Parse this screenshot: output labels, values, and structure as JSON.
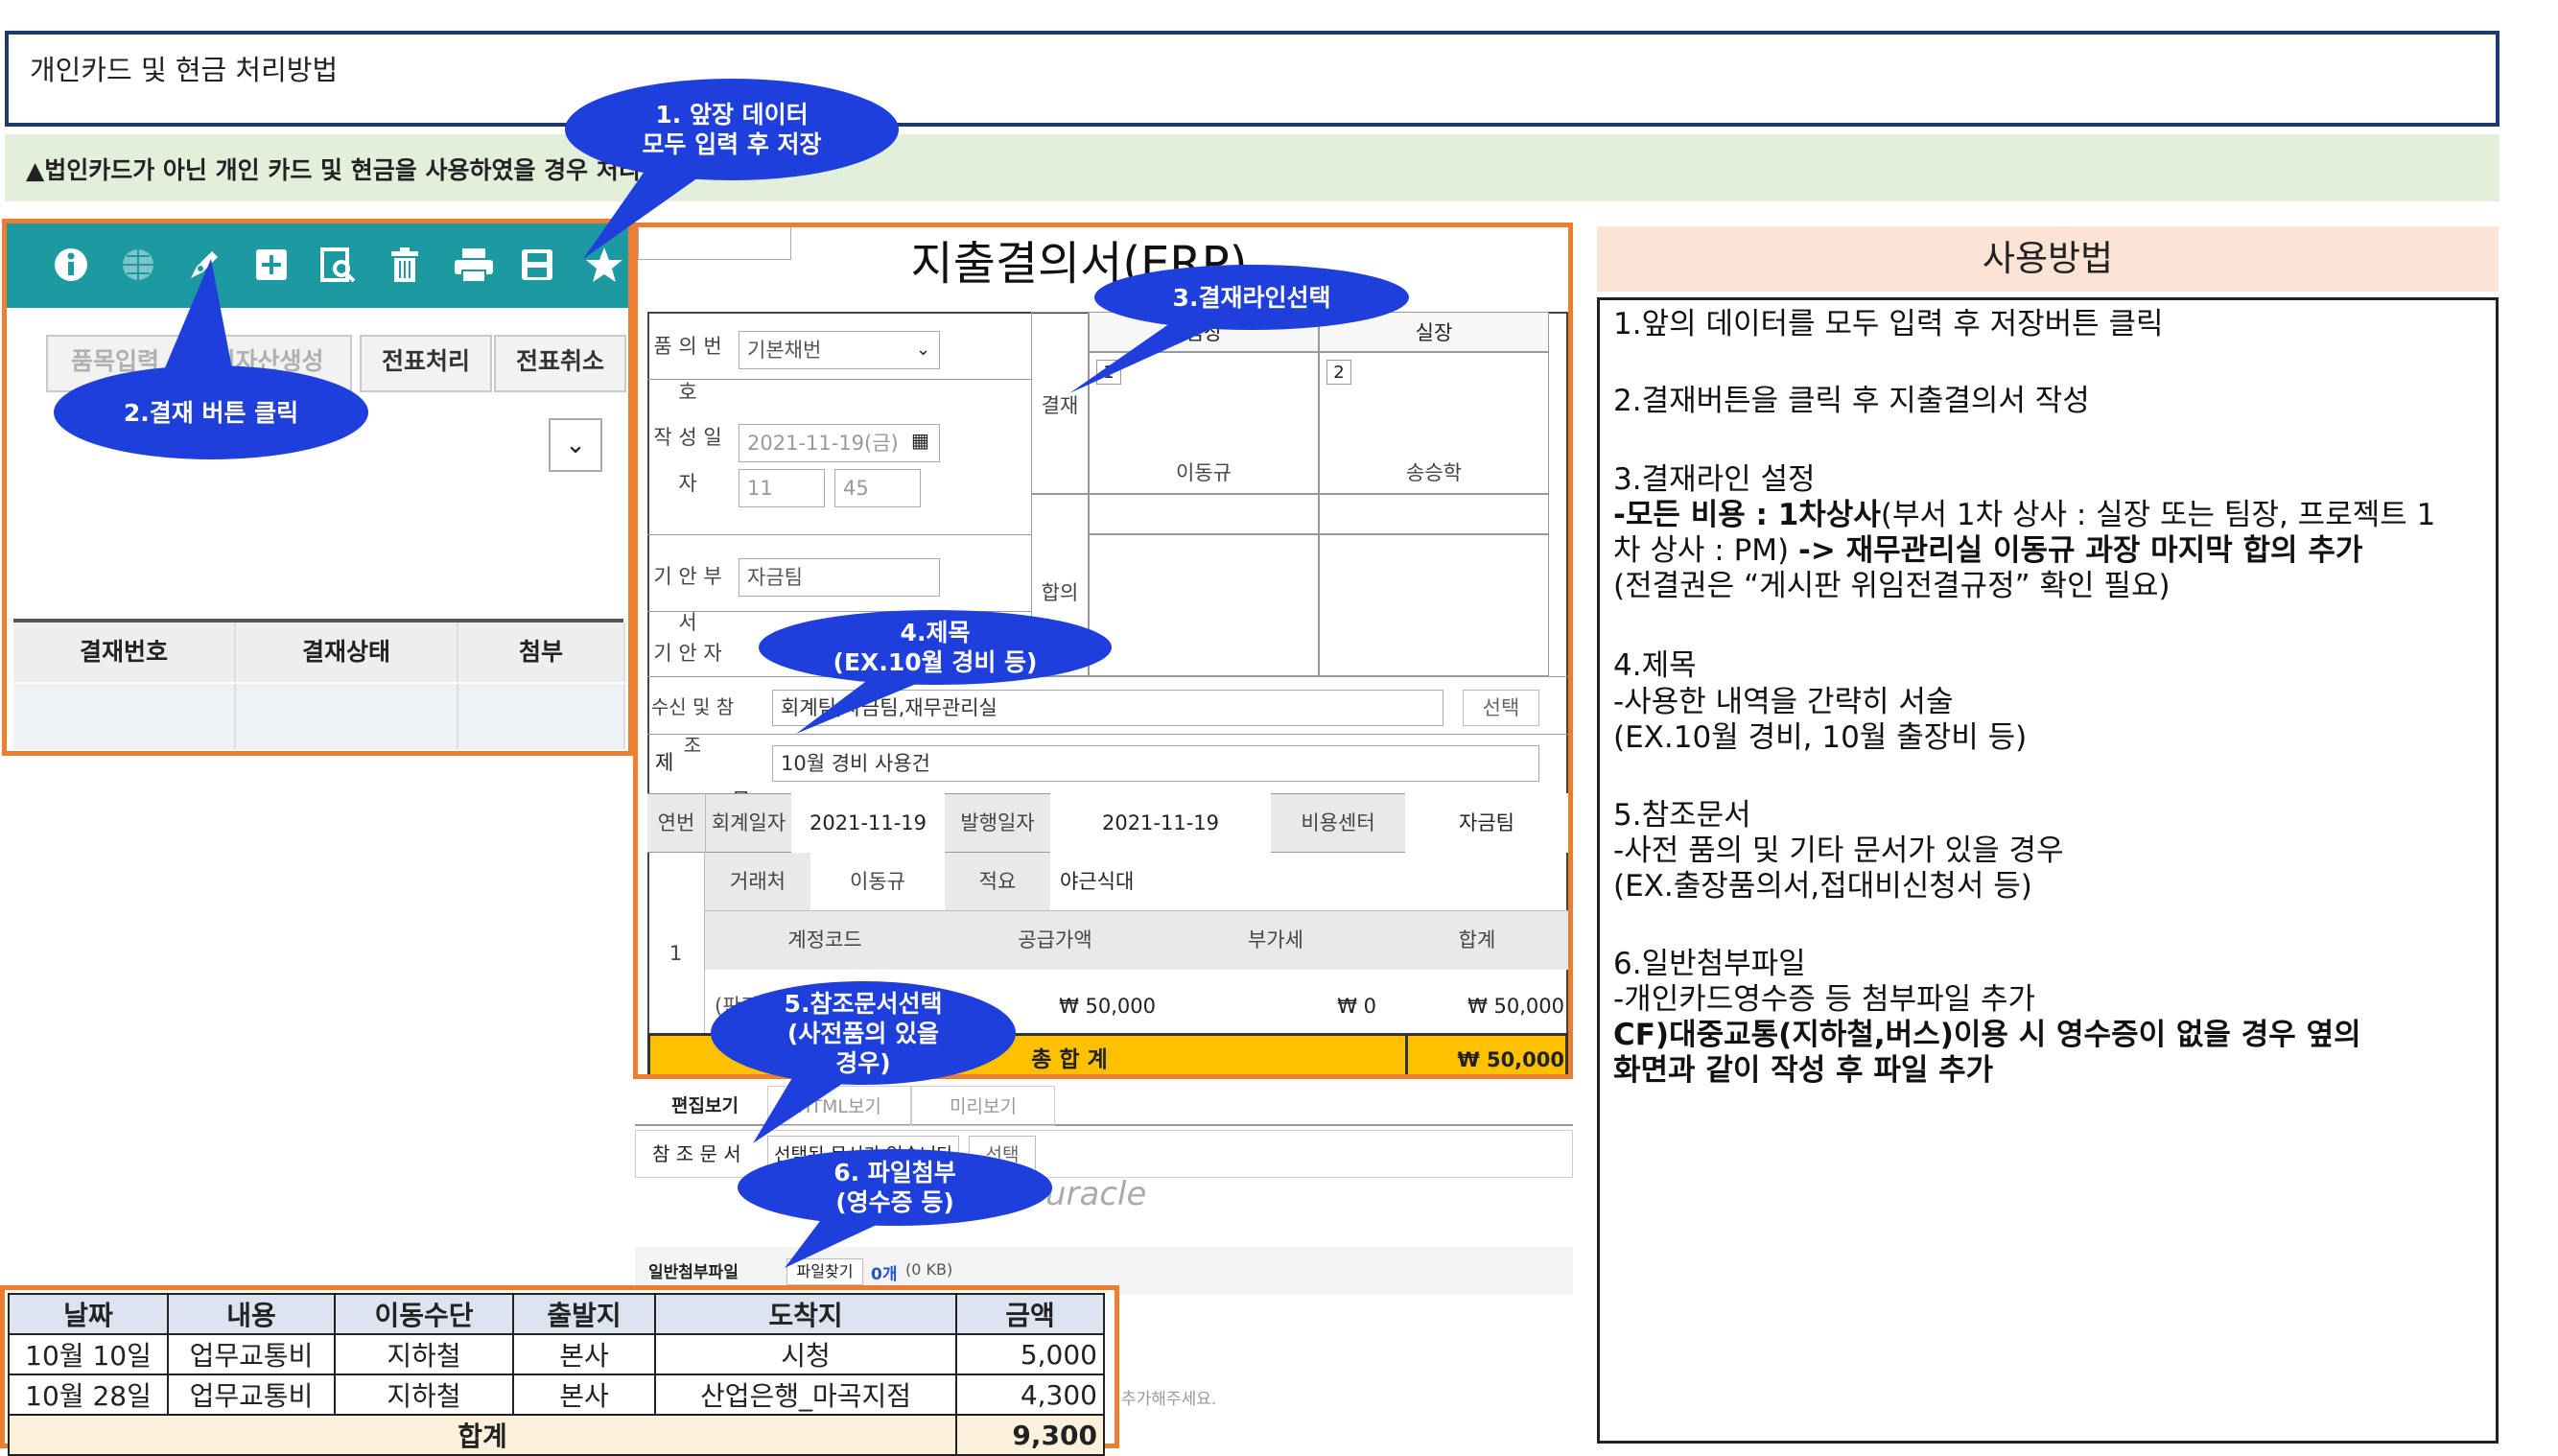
{
  "title": "개인카드 및 현금 처리방법",
  "notice": "▲법인카드가 아닌 개인 카드 및 현금을 사용하였을 경우 처리방법",
  "toolbar": {
    "icons": [
      "info-icon",
      "globe-icon",
      "pen-icon",
      "plus-icon",
      "preview-icon",
      "trash-icon",
      "print-icon",
      "save-icon",
      "star-icon"
    ],
    "buttons": [
      "품목입력",
      "전자산생성",
      "전표처리",
      "전표취소"
    ],
    "table_headers": [
      "결재번호",
      "결재상태",
      "첨부"
    ]
  },
  "form": {
    "title": "지출결의서(ERP)",
    "labels": {
      "doc_no": "품 의 번 호",
      "date": "작 성 일 자",
      "dept": "기 안 부 서",
      "drafter": "기 안 자",
      "recipient": "수신 및 참조",
      "subject": "제 목",
      "approval": "결재",
      "agreement": "합의",
      "approver2": "실장",
      "approver1": "팀장"
    },
    "doc_no_value": "기본채번",
    "date_value": "2021-11-19(금)",
    "hour": "11",
    "minute": "45",
    "dept_value": "자금팀",
    "recipient_value": "회계팀,자금팀,재무관리실",
    "select_btn": "선택",
    "subject_value": "10월 경비 사용건",
    "approval_no1": "1",
    "approval_no2": "2",
    "approver1_name": "이동규",
    "approver2_name": "송승학",
    "grid": {
      "row_no_label": "연번",
      "acct_date_label": "회계일자",
      "acct_date": "2021-11-19",
      "issue_date_label": "발행일자",
      "issue_date": "2021-11-19",
      "cost_center_label": "비용센터",
      "cost_center": "자금팀",
      "row_no": "1",
      "vendor_label": "거래처",
      "vendor": "이동규",
      "memo_label": "적요",
      "memo": "야근식대",
      "headers": [
        "계정코드",
        "공급가액",
        "부가세",
        "합계"
      ],
      "account": "(판관)복리후생비(식대)",
      "supply": "₩ 50,000",
      "vat": "₩ 0",
      "sum": "₩ 50,000",
      "total_label": "총 합 계",
      "total_sum": "₩ 50,000"
    },
    "tabs": [
      "편집보기",
      "HTML보기",
      "미리보기"
    ],
    "ref_label": "참 조 문 서",
    "ref_value": "선택된 문서가 없습니다",
    "logo": "uracle",
    "attach_label": "일반첨부파일",
    "attach_btn": "파일찾기",
    "attach_count": "0개",
    "attach_size": "(0 KB)",
    "hint": "파일을 끌어 추가해주세요."
  },
  "callouts": {
    "c1": [
      "1. 앞장 데이터",
      "모두 입력 후 저장"
    ],
    "c2": [
      "2.결재 버튼 클릭"
    ],
    "c3": [
      "3.결재라인선택"
    ],
    "c4": [
      "4.제목",
      "(EX.10월 경비 등)"
    ],
    "c5": [
      "5.참조문서선택",
      "(사전품의 있을",
      "경우)"
    ],
    "c6": [
      "6. 파일첨부",
      "(영수증 등)"
    ]
  },
  "usage": {
    "heading": "사용방법",
    "l1": "1.앞의 데이터를 모두 입력 후 저장버튼 클릭",
    "l2": "2.결재버튼을 클릭 후 지출결의서 작성",
    "l3": "3.결재라인 설정",
    "l3a_b": "-모든 비용 : 1차상사",
    "l3a": "(부서 1차 상사 : 실장 또는 팀장, 프로젝트 1",
    "l3b": "차 상사 : PM) ",
    "l3b_b": "-> 재무관리실 이동규 과장 마지막 합의 추가",
    "l3c": "(전결권은 “게시판 위임전결규정” 확인 필요)",
    "l4": "4.제목",
    "l4a": "-사용한 내역을 간략히 서술",
    "l4b": "(EX.10월 경비, 10월 출장비 등)",
    "l5": "5.참조문서",
    "l5a": "-사전 품의 및 기타 문서가 있을 경우",
    "l5b": "(EX.출장품의서,접대비신청서 등)",
    "l6": "6.일반첨부파일",
    "l6a": "-개인카드영수증 등 첨부파일 추가",
    "l6b": "CF)대중교통(지하철,버스)이용 시 영수증이 없을 경우 옆의",
    "l6c": "화면과 같이 작성 후 파일 추가"
  },
  "transport": {
    "headers": [
      "날짜",
      "내용",
      "이동수단",
      "출발지",
      "도착지",
      "금액"
    ],
    "rows": [
      [
        "10월 10일",
        "업무교통비",
        "지하철",
        "본사",
        "시청",
        "5,000"
      ],
      [
        "10월 28일",
        "업무교통비",
        "지하철",
        "본사",
        "산업은행_마곡지점",
        "4,300"
      ]
    ],
    "total_label": "합계",
    "total": "9,300"
  },
  "colors": {
    "accent_orange": "#ed7d31",
    "callout_blue": "#1f3fdc",
    "teal": "#1d9aa1",
    "title_border": "#1f3a6e",
    "total_yellow": "#ffc000"
  }
}
